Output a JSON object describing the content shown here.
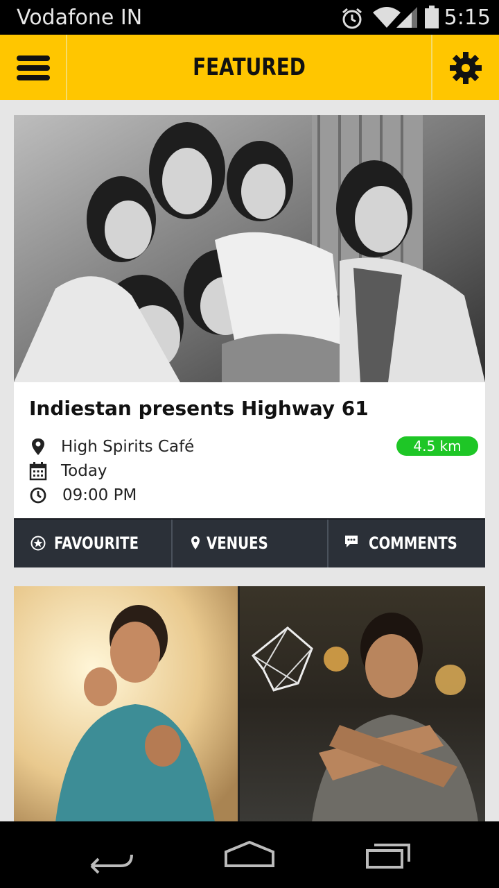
{
  "status_bar": {
    "carrier": "Vodafone IN",
    "time": "5:15",
    "icons": [
      "alarm-icon",
      "wifi-icon",
      "signal-icon",
      "battery-icon"
    ]
  },
  "app_bar": {
    "title": "FEATURED",
    "menu_icon": "hamburger-menu-icon",
    "settings_icon": "gear-icon",
    "background_color": "#ffc600"
  },
  "events": [
    {
      "title": "Indiestan presents Highway 61",
      "venue": "High Spirits Café",
      "distance": "4.5 km",
      "date": "Today",
      "time": "09:00 PM",
      "actions": [
        {
          "label": "FAVOURITE",
          "icon": "star-badge-icon"
        },
        {
          "label": "VENUES",
          "icon": "location-pin-icon"
        },
        {
          "label": "COMMENTS",
          "icon": "chat-bubble-icon"
        }
      ]
    }
  ],
  "colors": {
    "distance_badge": "#1ec626",
    "action_bar": "#2b3038"
  },
  "nav_bar": {
    "icons": [
      "back-icon",
      "home-icon",
      "recent-apps-icon"
    ]
  }
}
